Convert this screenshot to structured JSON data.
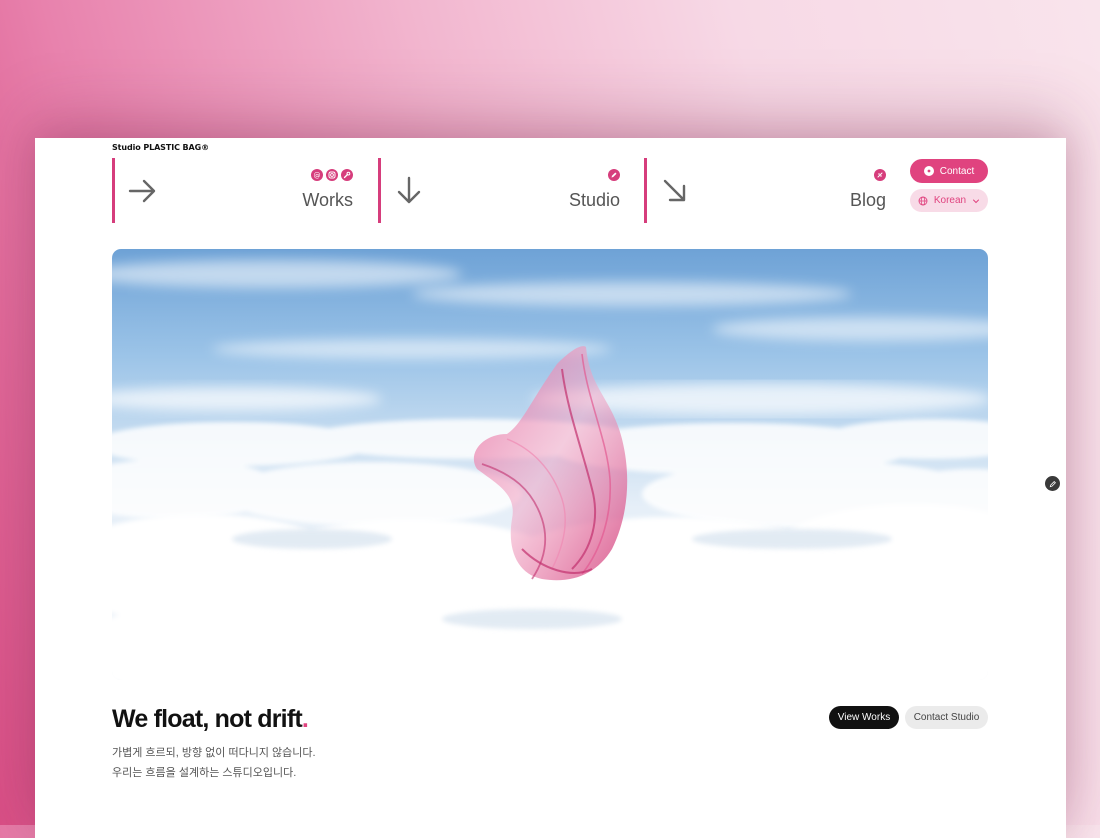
{
  "brand": "Studio PLASTIC BAG®",
  "nav": {
    "works": {
      "label": "Works",
      "icons": [
        "threads-icon",
        "instagram-icon",
        "wrench-icon"
      ]
    },
    "studio": {
      "label": "Studio",
      "icons": [
        "pencil-icon"
      ]
    },
    "blog": {
      "label": "Blog",
      "icons": [
        "blog-icon"
      ]
    },
    "arrows": [
      "arrow-right-icon",
      "arrow-down-icon",
      "arrow-down-right-icon"
    ]
  },
  "actions": {
    "contact_label": "Contact",
    "language_label": "Korean"
  },
  "hero": {
    "image_alt": "pink plastic bag floating above clouds"
  },
  "intro": {
    "headline": "We float, not drift",
    "headline_period": ".",
    "line1": "가볍게 흐르되, 방향 없이 떠다니지 않습니다.",
    "line2": "우리는 흐름을 설계하는 스튜디오입니다.",
    "view_works": "View Works",
    "contact_studio": "Contact Studio"
  },
  "colors": {
    "accent": "#e0437f",
    "bar": "#d63d7c",
    "dark": "#111111"
  }
}
